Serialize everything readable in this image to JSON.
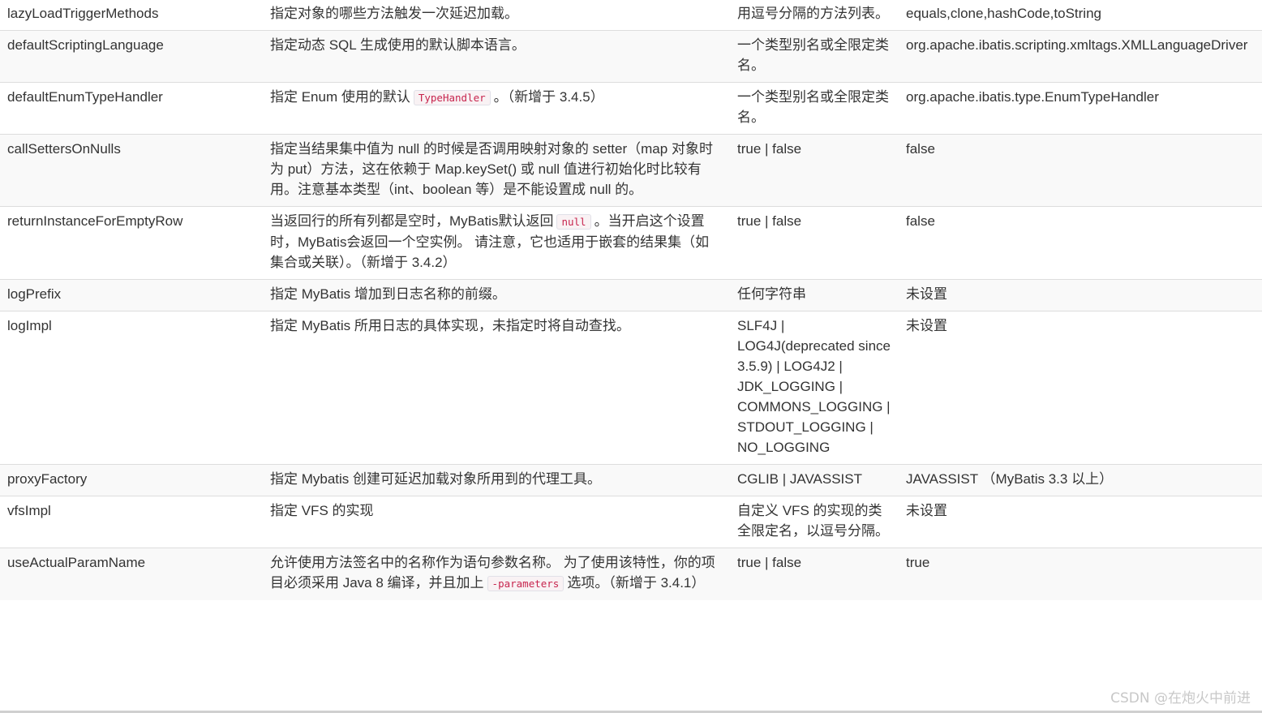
{
  "table": {
    "rows": [
      {
        "name": "lazyLoadTriggerMethods",
        "desc": "指定对象的哪些方法触发一次延迟加载。",
        "values": "用逗号分隔的方法列表。",
        "default": "equals,clone,hashCode,toString"
      },
      {
        "name": "defaultScriptingLanguage",
        "desc": "指定动态 SQL 生成使用的默认脚本语言。",
        "values": "一个类型别名或全限定类名。",
        "default": "org.apache.ibatis.scripting.xmltags.XMLLanguageDriver"
      },
      {
        "name": "defaultEnumTypeHandler",
        "desc_pre": "指定 Enum 使用的默认",
        "desc_code": "TypeHandler",
        "desc_post": "。（新增于 3.4.5）",
        "values": "一个类型别名或全限定类名。",
        "default": "org.apache.ibatis.type.EnumTypeHandler"
      },
      {
        "name": "callSettersOnNulls",
        "desc": "指定当结果集中值为 null 的时候是否调用映射对象的 setter（map 对象时为 put）方法，这在依赖于 Map.keySet() 或 null 值进行初始化时比较有用。注意基本类型（int、boolean 等）是不能设置成 null 的。",
        "values": "true | false",
        "default": "false"
      },
      {
        "name": "returnInstanceForEmptyRow",
        "desc_pre": "当返回行的所有列都是空时，MyBatis默认返回",
        "desc_code": "null",
        "desc_post": "。当开启这个设置时，MyBatis会返回一个空实例。 请注意，它也适用于嵌套的结果集（如集合或关联）。（新增于 3.4.2）",
        "values": "true | false",
        "default": "false"
      },
      {
        "name": "logPrefix",
        "desc": "指定 MyBatis 增加到日志名称的前缀。",
        "values": "任何字符串",
        "default": "未设置"
      },
      {
        "name": "logImpl",
        "desc": "指定 MyBatis 所用日志的具体实现，未指定时将自动查找。",
        "values": "SLF4J | LOG4J(deprecated since 3.5.9) | LOG4J2 | JDK_LOGGING | COMMONS_LOGGING | STDOUT_LOGGING | NO_LOGGING",
        "default": "未设置"
      },
      {
        "name": "proxyFactory",
        "desc": "指定 Mybatis 创建可延迟加载对象所用到的代理工具。",
        "values": "CGLIB | JAVASSIST",
        "default": "JAVASSIST （MyBatis 3.3 以上）"
      },
      {
        "name": "vfsImpl",
        "desc": "指定 VFS 的实现",
        "values": "自定义 VFS 的实现的类全限定名，以逗号分隔。",
        "default": "未设置"
      },
      {
        "name": "useActualParamName",
        "desc_pre": "允许使用方法签名中的名称作为语句参数名称。 为了使用该特性，你的项目必须采用 Java 8 编译，并且加上",
        "desc_code": "-parameters",
        "desc_post": "选项。（新增于 3.4.1）",
        "values": "true | false",
        "default": "true"
      }
    ]
  },
  "watermark": "CSDN @在炮火中前进"
}
